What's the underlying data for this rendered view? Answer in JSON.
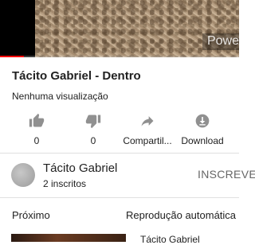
{
  "player": {
    "watermark": "Powe",
    "progress_fraction": 0.1
  },
  "video": {
    "title": "Tácito Gabriel - Dentro",
    "views": "Nenhuma visualização"
  },
  "actions": [
    {
      "icon": "thumbs-up-icon",
      "label": "0"
    },
    {
      "icon": "thumbs-down-icon",
      "label": "0"
    },
    {
      "icon": "share-icon",
      "label": "Compartil..."
    },
    {
      "icon": "download-icon",
      "label": "Download"
    }
  ],
  "channel": {
    "name": "Tácito Gabriel",
    "subscribers": "2 inscritos",
    "subscribe_label": "INSCREVER"
  },
  "up_next": {
    "label": "Próximo",
    "autoplay_label": "Reprodução automática",
    "next_title": "Tácito Gabriel"
  },
  "colors": {
    "progress": "#ff0000",
    "icon": "#909090"
  }
}
